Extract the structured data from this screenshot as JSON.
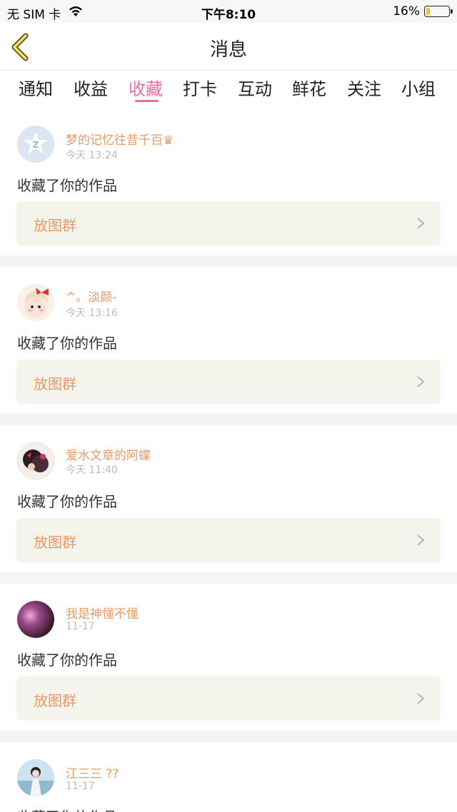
{
  "status_bar": {
    "carrier": "无 SIM 卡",
    "time": "下午8:10",
    "battery": "16%",
    "battery_level": 0.16
  },
  "header": {
    "title": "消息"
  },
  "tabs": [
    {
      "label": "通知",
      "active": false
    },
    {
      "label": "收益",
      "active": false
    },
    {
      "label": "收藏",
      "active": true
    },
    {
      "label": "打卡",
      "active": false
    },
    {
      "label": "互动",
      "active": false
    },
    {
      "label": "鲜花",
      "active": false
    },
    {
      "label": "关注",
      "active": false
    },
    {
      "label": "小组",
      "active": false
    }
  ],
  "colors": {
    "accent": "#e8709f",
    "name": "#e89a66",
    "box": "#f4f4ed"
  },
  "items": [
    {
      "name": "梦的记忆往昔千百♛",
      "time": "今天 13:24",
      "action": "收藏了你的作品",
      "work": "放图群"
    },
    {
      "name": "^。淡颜-",
      "time": "今天 13:16",
      "action": "收藏了你的作品",
      "work": "放图群"
    },
    {
      "name": "爱水文章的阿蝶",
      "time": "今天 11:40",
      "action": "收藏了你的作品",
      "work": "放图群"
    },
    {
      "name": "我是神懂不懂",
      "time": "11-17",
      "action": "收藏了你的作品",
      "work": "放图群"
    },
    {
      "name": "江三三 ??",
      "time": "11-17",
      "action": "收藏了你的作品"
    }
  ]
}
